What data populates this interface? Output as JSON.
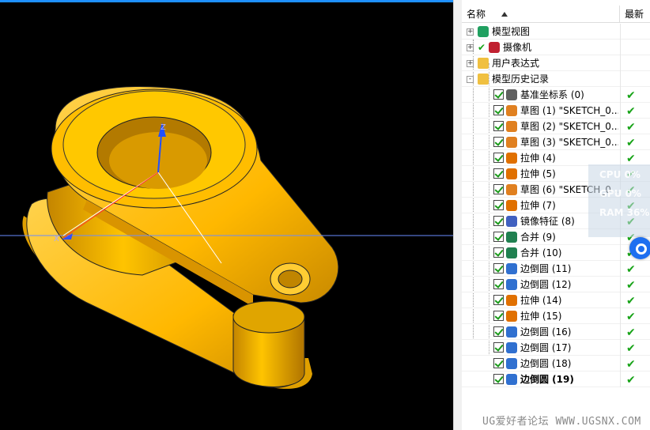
{
  "navigator": {
    "header": {
      "name": "名称",
      "latest": "最新"
    },
    "nodes": [
      {
        "label": "模型视图",
        "icon": "model-views-icon",
        "expander": "+",
        "bold": false,
        "checked": false,
        "latest": ""
      },
      {
        "label": "摄像机",
        "icon": "camera-icon",
        "expander": "+",
        "bold": false,
        "checked": false,
        "latest": ""
      },
      {
        "label": "用户表达式",
        "icon": "folder-icon",
        "expander": "+",
        "bold": false,
        "checked": false,
        "latest": ""
      },
      {
        "label": "模型历史记录",
        "icon": "folder-open-icon",
        "expander": "-",
        "bold": false,
        "checked": false,
        "latest": ""
      },
      {
        "label": "基准坐标系 (0)",
        "icon": "datum-csys-icon",
        "checked": true,
        "latest": "✔",
        "bold": false
      },
      {
        "label": "草图 (1) \"SKETCH_0...",
        "icon": "sketch-icon",
        "checked": true,
        "latest": "✔",
        "bold": false
      },
      {
        "label": "草图 (2) \"SKETCH_0...",
        "icon": "sketch-icon",
        "checked": true,
        "latest": "✔",
        "bold": false
      },
      {
        "label": "草图 (3) \"SKETCH_0...",
        "icon": "sketch-icon",
        "checked": true,
        "latest": "✔",
        "bold": false
      },
      {
        "label": "拉伸 (4)",
        "icon": "extrude-icon",
        "checked": true,
        "latest": "✔",
        "bold": false
      },
      {
        "label": "拉伸 (5)",
        "icon": "extrude-icon",
        "checked": true,
        "latest": "✔",
        "bold": false
      },
      {
        "label": "草图 (6) \"SKETCH_0...",
        "icon": "sketch-icon",
        "checked": true,
        "latest": "✔",
        "bold": false
      },
      {
        "label": "拉伸 (7)",
        "icon": "extrude-icon",
        "checked": true,
        "latest": "✔",
        "bold": false
      },
      {
        "label": "镜像特征 (8)",
        "icon": "mirror-icon",
        "checked": true,
        "latest": "✔",
        "bold": false
      },
      {
        "label": "合并 (9)",
        "icon": "unite-icon",
        "checked": true,
        "latest": "✔",
        "bold": false
      },
      {
        "label": "合并 (10)",
        "icon": "unite-icon",
        "checked": true,
        "latest": "✔",
        "bold": false
      },
      {
        "label": "边倒圆 (11)",
        "icon": "edge-blend-icon",
        "checked": true,
        "latest": "✔",
        "bold": false
      },
      {
        "label": "边倒圆 (12)",
        "icon": "edge-blend-icon",
        "checked": true,
        "latest": "✔",
        "bold": false
      },
      {
        "label": "拉伸 (14)",
        "icon": "extrude-icon",
        "checked": true,
        "latest": "✔",
        "bold": false
      },
      {
        "label": "拉伸 (15)",
        "icon": "extrude-icon",
        "checked": true,
        "latest": "✔",
        "bold": false
      },
      {
        "label": "边倒圆 (16)",
        "icon": "edge-blend-icon",
        "checked": true,
        "latest": "✔",
        "bold": false
      },
      {
        "label": "边倒圆 (17)",
        "icon": "edge-blend-icon",
        "checked": true,
        "latest": "✔",
        "bold": false
      },
      {
        "label": "边倒圆 (18)",
        "icon": "edge-blend-icon",
        "checked": true,
        "latest": "✔",
        "bold": false
      },
      {
        "label": "边倒圆 (19)",
        "icon": "edge-blend-icon",
        "checked": true,
        "latest": "✔",
        "bold": true
      }
    ]
  },
  "perf_overlay": {
    "cpu1": "CPU 0%",
    "cpu2": "GPU 0%",
    "ram": "RAM 36%"
  },
  "viewport": {
    "axis_x": "X",
    "axis_z": "Z"
  },
  "watermark": "UG爱好者论坛 WWW.UGSNX.COM",
  "colors": {
    "model": "#ffc000",
    "background": "#000000",
    "check": "#17a317"
  }
}
